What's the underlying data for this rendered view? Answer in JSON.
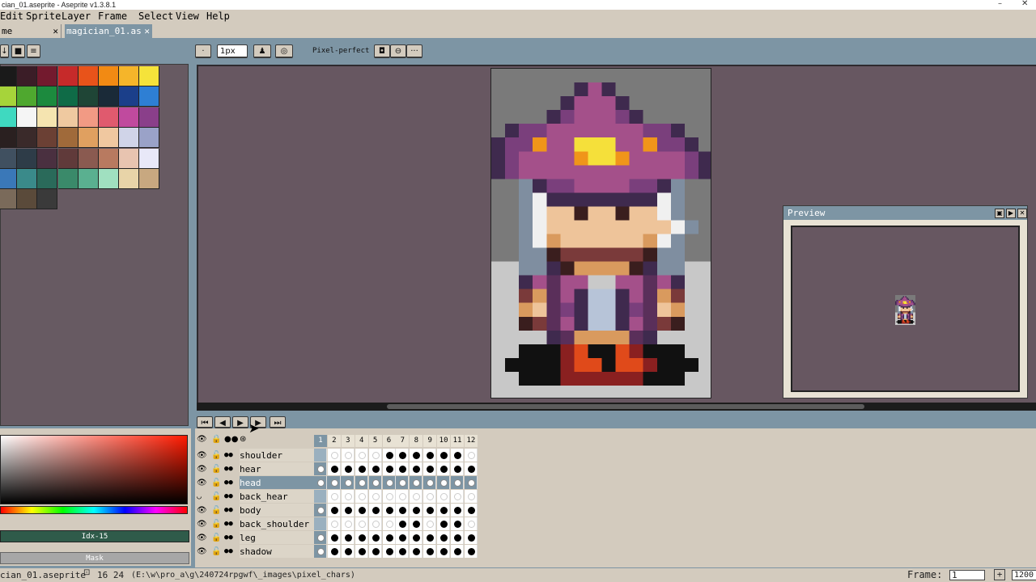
{
  "window": {
    "title": "cian_01.aseprite - Aseprite v1.3.8.1",
    "minimize": "–",
    "close": "✕"
  },
  "menu": [
    "Edit",
    "Sprite",
    "Layer",
    "Frame",
    "Select",
    "View",
    "Help"
  ],
  "tabs": [
    {
      "label": "me",
      "close": "✕"
    },
    {
      "label": "magician_01.as",
      "close": "✕"
    }
  ],
  "toolbar": {
    "brush_size": "1px",
    "pixel_perfect": "Pixel-perfect",
    "more": "···"
  },
  "palette": {
    "colors": [
      "#1a1a1a",
      "#3b1d27",
      "#731a2e",
      "#c62a2a",
      "#e8531a",
      "#f28a13",
      "#f5b52a",
      "#f5e33a",
      "#a6d43a",
      "#4fa82f",
      "#1c8a3e",
      "#0f6b47",
      "#1f4536",
      "#1a2a38",
      "#1b3f8a",
      "#2e7fd4",
      "#3fd9c0",
      "#f5f5f5",
      "#f5e4b0",
      "#efc9a0",
      "#f29a84",
      "#e05a6e",
      "#c04a9e",
      "#8a3f8a",
      "#2a2020",
      "#3a2a2a",
      "#6b4034",
      "#a06a3a",
      "#e0a060",
      "#f0c8a0",
      "#d0d4e8",
      "#9aa2c8",
      "#405060",
      "#2e3c48",
      "#4a3040",
      "#603a3a",
      "#8a5a50",
      "#b87a60",
      "#e8c4b0",
      "#e8e8f8",
      "#3a78b8",
      "#3a8a8a",
      "#2a6a5a",
      "#3a8a6a",
      "#5ab090",
      "#a0e0c0",
      "#e8d4a8",
      "#c8a880",
      "#7a6a5a",
      "#5a4a3a",
      "#3a3a3a"
    ]
  },
  "canvas": {
    "fill": "#675761"
  },
  "preview": {
    "title": "Preview",
    "buttons": [
      "▣",
      "▶",
      "✕"
    ]
  },
  "color_panel": {
    "index": "Idx-15",
    "mask": "Mask"
  },
  "timeline": {
    "frames": [
      "1",
      "2",
      "3",
      "4",
      "5",
      "6",
      "7",
      "8",
      "9",
      "10",
      "11",
      "12"
    ],
    "layers": [
      {
        "name": "shoulder",
        "cels": "e....xxxxxx",
        "active": false,
        "visible": true
      },
      {
        "name": "hear",
        "cels": "wxxxxxxxxxxx",
        "active": false,
        "visible": true
      },
      {
        "name": "head",
        "cels": "wwwwwwwwwwww",
        "active": true,
        "visible": true
      },
      {
        "name": "back_hear",
        "cels": "e...........",
        "active": false,
        "visible": false
      },
      {
        "name": "body",
        "cels": "wxxxxxxxxxxx",
        "active": false,
        "visible": true
      },
      {
        "name": "back_shoulder",
        "cels": "e.....xx.xx",
        "active": false,
        "visible": true
      },
      {
        "name": "leg",
        "cels": "wxxxxxxxxxxx",
        "active": false,
        "visible": true
      },
      {
        "name": "shadow",
        "cels": "wxxxxxxxxxxx",
        "active": false,
        "visible": true
      }
    ]
  },
  "status": {
    "file": "cian_01.aseprite",
    "size": "16  24",
    "path": "(E:\\w\\pro_a\\g\\240724rpgwf\\_images\\pixel_chars)",
    "frame_label": "Frame:",
    "frame_value": "1",
    "zoom": "1200"
  }
}
